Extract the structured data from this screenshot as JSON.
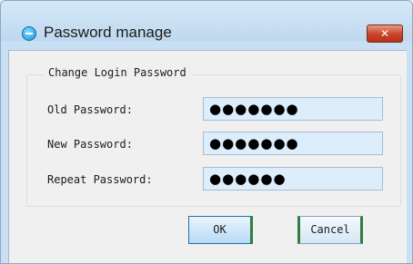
{
  "window": {
    "title": "Password manage",
    "close_label": "✕"
  },
  "group": {
    "legend": "Change Login Password"
  },
  "fields": {
    "old_password": {
      "label": "Old Password:",
      "value": "●●●●●●●"
    },
    "new_password": {
      "label": "New Password:",
      "value": "●●●●●●●"
    },
    "repeat_password": {
      "label": "Repeat Password:",
      "value": "●●●●●●"
    }
  },
  "buttons": {
    "ok_label": "OK",
    "cancel_label": "Cancel"
  },
  "colors": {
    "title_bar": "#c9dff3",
    "close_button": "#c8432a",
    "field_background": "#dcedfb",
    "button_accent": "#2f7e3f"
  }
}
